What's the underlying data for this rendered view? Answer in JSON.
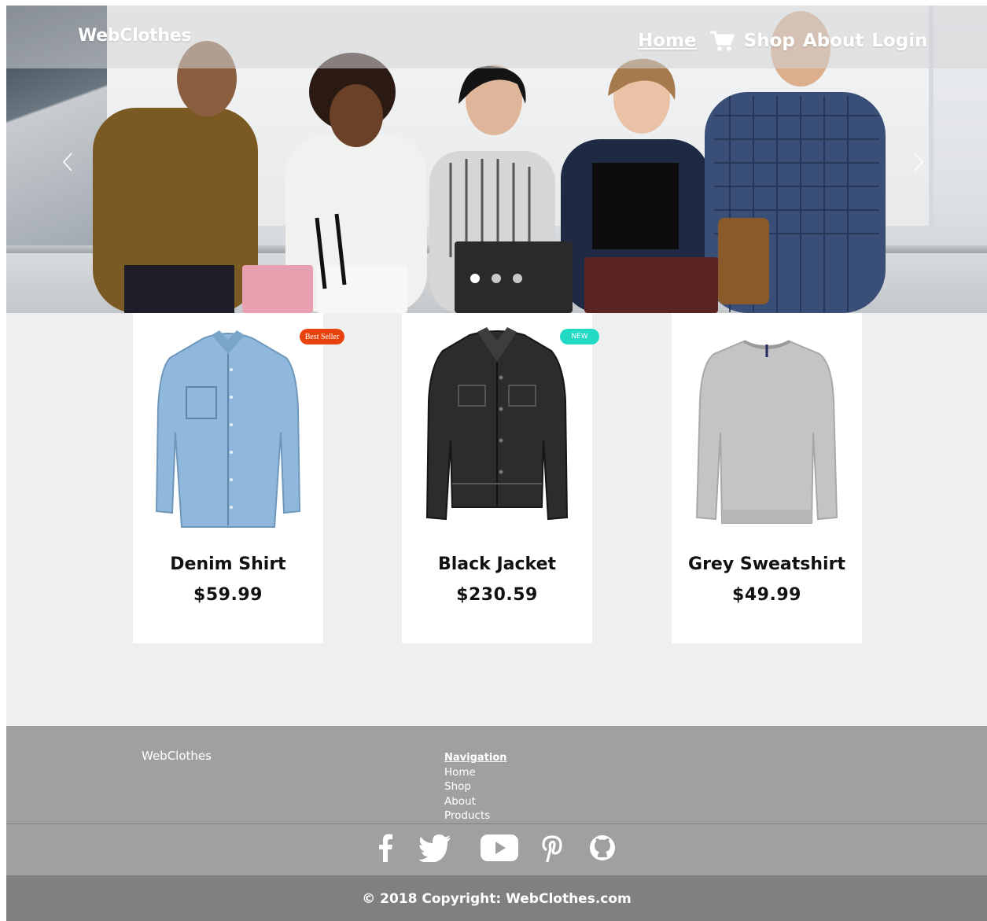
{
  "header": {
    "brand": "WebClothes",
    "nav": [
      {
        "label": "Home",
        "active": true
      },
      {
        "label": "Shop",
        "icon": "shopping-cart-icon"
      },
      {
        "label": "About"
      },
      {
        "label": "Login"
      }
    ]
  },
  "carousel": {
    "slides": 3,
    "active_slide": 1,
    "prev_icon": "chevron-left-icon",
    "next_icon": "chevron-right-icon"
  },
  "products": [
    {
      "name": "Denim Shirt",
      "price": "$59.99",
      "badge": "Best Seller",
      "badge_color": "#e8420e",
      "image_icon": "denim-shirt-image"
    },
    {
      "name": "Black Jacket",
      "price": "$230.59",
      "badge": "NEW",
      "badge_color": "#22d9c4",
      "image_icon": "black-jacket-image"
    },
    {
      "name": "Grey Sweatshirt",
      "price": "$49.99",
      "badge": "",
      "image_icon": "grey-sweatshirt-image"
    }
  ],
  "footer": {
    "brand": "WebClothes",
    "nav_heading": "Navigation",
    "nav_links": [
      "Home",
      "Shop",
      "About",
      "Products"
    ],
    "social": [
      "facebook-icon",
      "twitter-icon",
      "youtube-icon",
      "pinterest-icon",
      "github-icon"
    ],
    "copyright": "© 2018 Copyright: WebClothes.com"
  },
  "colors": {
    "page_bg": "#efefef",
    "footer_bg": "#a0a0a0",
    "footer_bottom_bg": "#808080",
    "badge_best_seller": "#e8420e",
    "badge_new": "#22d9c4"
  }
}
